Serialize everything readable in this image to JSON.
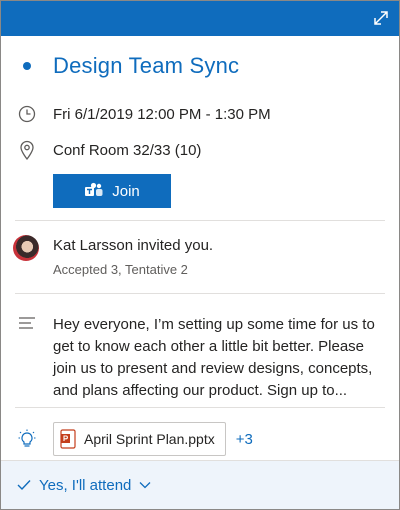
{
  "header": {
    "expand_icon": "expand-icon",
    "color": "#0f6cbd"
  },
  "event": {
    "title": "Design Team Sync",
    "datetime": "Fri 6/1/2019 12:00 PM - 1:30 PM",
    "location": "Conf Room 32/33 (10)",
    "join_label": "Join"
  },
  "invite": {
    "text": "Kat Larsson invited you.",
    "responses": "Accepted 3, Tentative 2"
  },
  "description": "Hey everyone, I’m setting up some time for us to get to know each other a little bit better. Please join us to present and review designs, concepts, and plans affecting our product. Sign up to...",
  "attachments": {
    "file_name": "April Sprint Plan.pptx",
    "more_count": "+3"
  },
  "rsvp": {
    "label": "Yes, I'll attend"
  },
  "colors": {
    "accent": "#0f6cbd",
    "footer_bg": "#eef4fb"
  }
}
